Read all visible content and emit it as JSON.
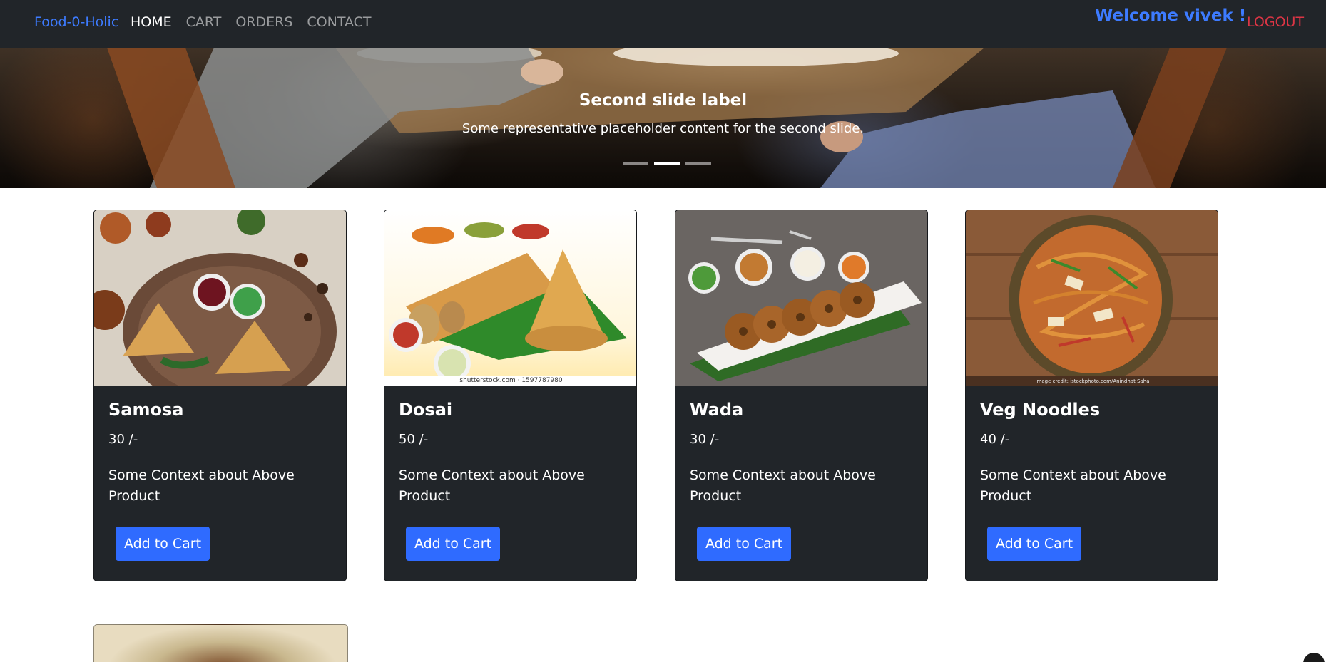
{
  "navbar": {
    "brand": "Food-0-Holic",
    "links": [
      "HOME",
      "CART",
      "ORDERS",
      "CONTACT"
    ],
    "welcome": "Welcome vivek !",
    "logout": "LOGOUT"
  },
  "carousel": {
    "title": "Second slide label",
    "text": "Some representative placeholder content for the second slide.",
    "active_index": 1,
    "slide_count": 3
  },
  "products": [
    {
      "name": "Samosa",
      "price": "30 /-",
      "description": "Some Context about Above Product",
      "button": "Add to Cart",
      "image": "samosa"
    },
    {
      "name": "Dosai",
      "price": "50 /-",
      "description": "Some Context about Above Product",
      "button": "Add to Cart",
      "image": "dosai",
      "image_caption": "shutterstock.com · 1597787980"
    },
    {
      "name": "Wada",
      "price": "30 /-",
      "description": "Some Context about Above Product",
      "button": "Add to Cart",
      "image": "wada"
    },
    {
      "name": "Veg Noodles",
      "price": "40 /-",
      "description": "Some Context about Above Product",
      "button": "Add to Cart",
      "image": "veg-noodles",
      "image_caption": "Image credit: istockphoto.com/Anindhat Saha"
    }
  ],
  "colors": {
    "navbar_bg": "#212529",
    "brand": "#3d7bff",
    "logout": "#dc3545",
    "card_bg": "#212529",
    "button": "#2f6bff"
  }
}
